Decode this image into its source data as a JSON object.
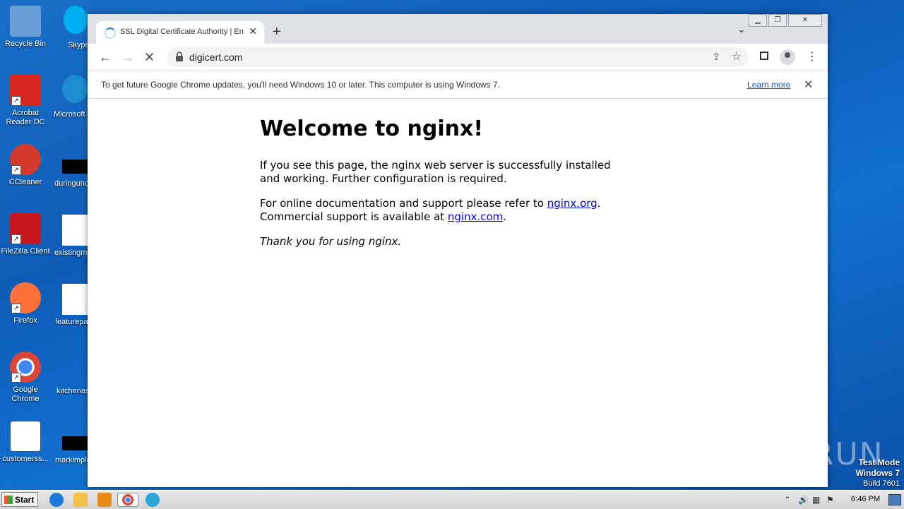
{
  "desktop": {
    "icons": [
      {
        "label": "Recycle Bin",
        "color": "#6aa0d8"
      },
      {
        "label": "Acrobat Reader DC",
        "color": "#d9261c"
      },
      {
        "label": "CCleaner",
        "color": "#d33a2c"
      },
      {
        "label": "FileZilla Client",
        "color": "#c4161c"
      },
      {
        "label": "Firefox",
        "color": "#ff7139"
      },
      {
        "label": "Google Chrome",
        "color": "#4285f4"
      },
      {
        "label": "customerss...",
        "color": "#2b579a"
      }
    ],
    "partial_icons": [
      "Skype",
      "Microsoft",
      "duringunc",
      "existingm",
      "featurepa",
      "kitchenas",
      "markimple"
    ]
  },
  "browser": {
    "tab_title": "SSL Digital Certificate Authority | En",
    "url": "digicert.com",
    "infobar_message": "To get future Google Chrome updates, you'll need Windows 10 or later. This computer is using Windows 7.",
    "infobar_link": "Learn more"
  },
  "page": {
    "heading": "Welcome to nginx!",
    "p1": "If you see this page, the nginx web server is successfully installed and working. Further configuration is required.",
    "p2_a": "For online documentation and support please refer to ",
    "link1": "nginx.org",
    "p2_b": ".",
    "p2_c": "Commercial support is available at ",
    "link2": "nginx.com",
    "p2_d": ".",
    "p3": "Thank you for using nginx."
  },
  "watermark": "ANY RUN",
  "test_mode": {
    "line1": "Test Mode",
    "line2": "Windows 7",
    "line3": "Build 7601"
  },
  "taskbar": {
    "start_label": "Start",
    "clock": "6:46 PM"
  }
}
